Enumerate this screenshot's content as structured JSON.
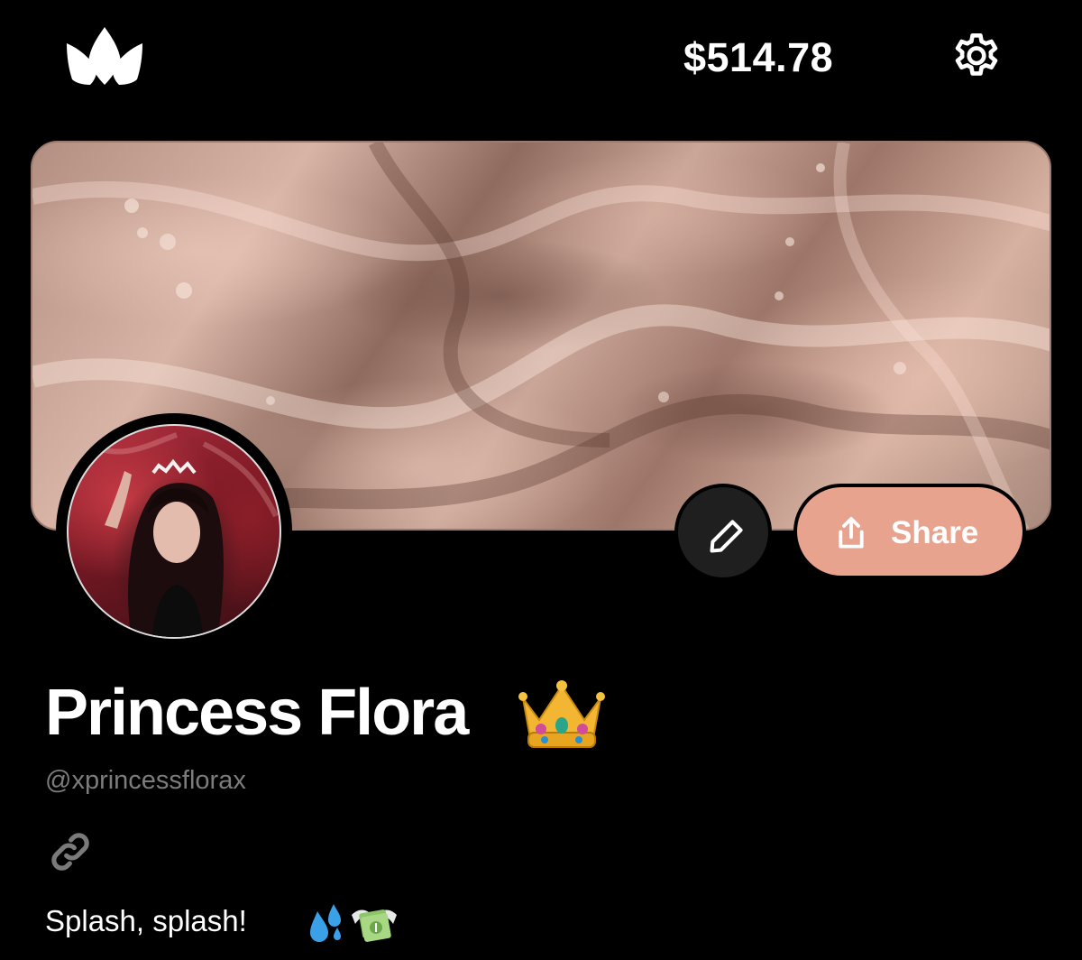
{
  "header": {
    "logo_icon": "crown-logo-icon",
    "balance": "$514.78",
    "settings_icon": "gear-icon"
  },
  "profile": {
    "banner_icon": "satin-banner-image",
    "avatar_icon": "profile-photo",
    "edit_icon": "pencil-icon",
    "share_icon": "share-upload-icon",
    "share_label": "Share",
    "name": "Princess Flora",
    "name_emoji": "crown-emoji",
    "handle": "@xprincessflorax",
    "link_icon": "link-icon",
    "bio": "Splash, splash!",
    "bio_emojis": [
      "sweat-droplets-emoji",
      "money-with-wings-emoji"
    ]
  },
  "colors": {
    "background": "#000000",
    "share_button": "#e8a38f",
    "edit_button": "#1f1f1f",
    "handle_text": "#7c7c7c"
  }
}
